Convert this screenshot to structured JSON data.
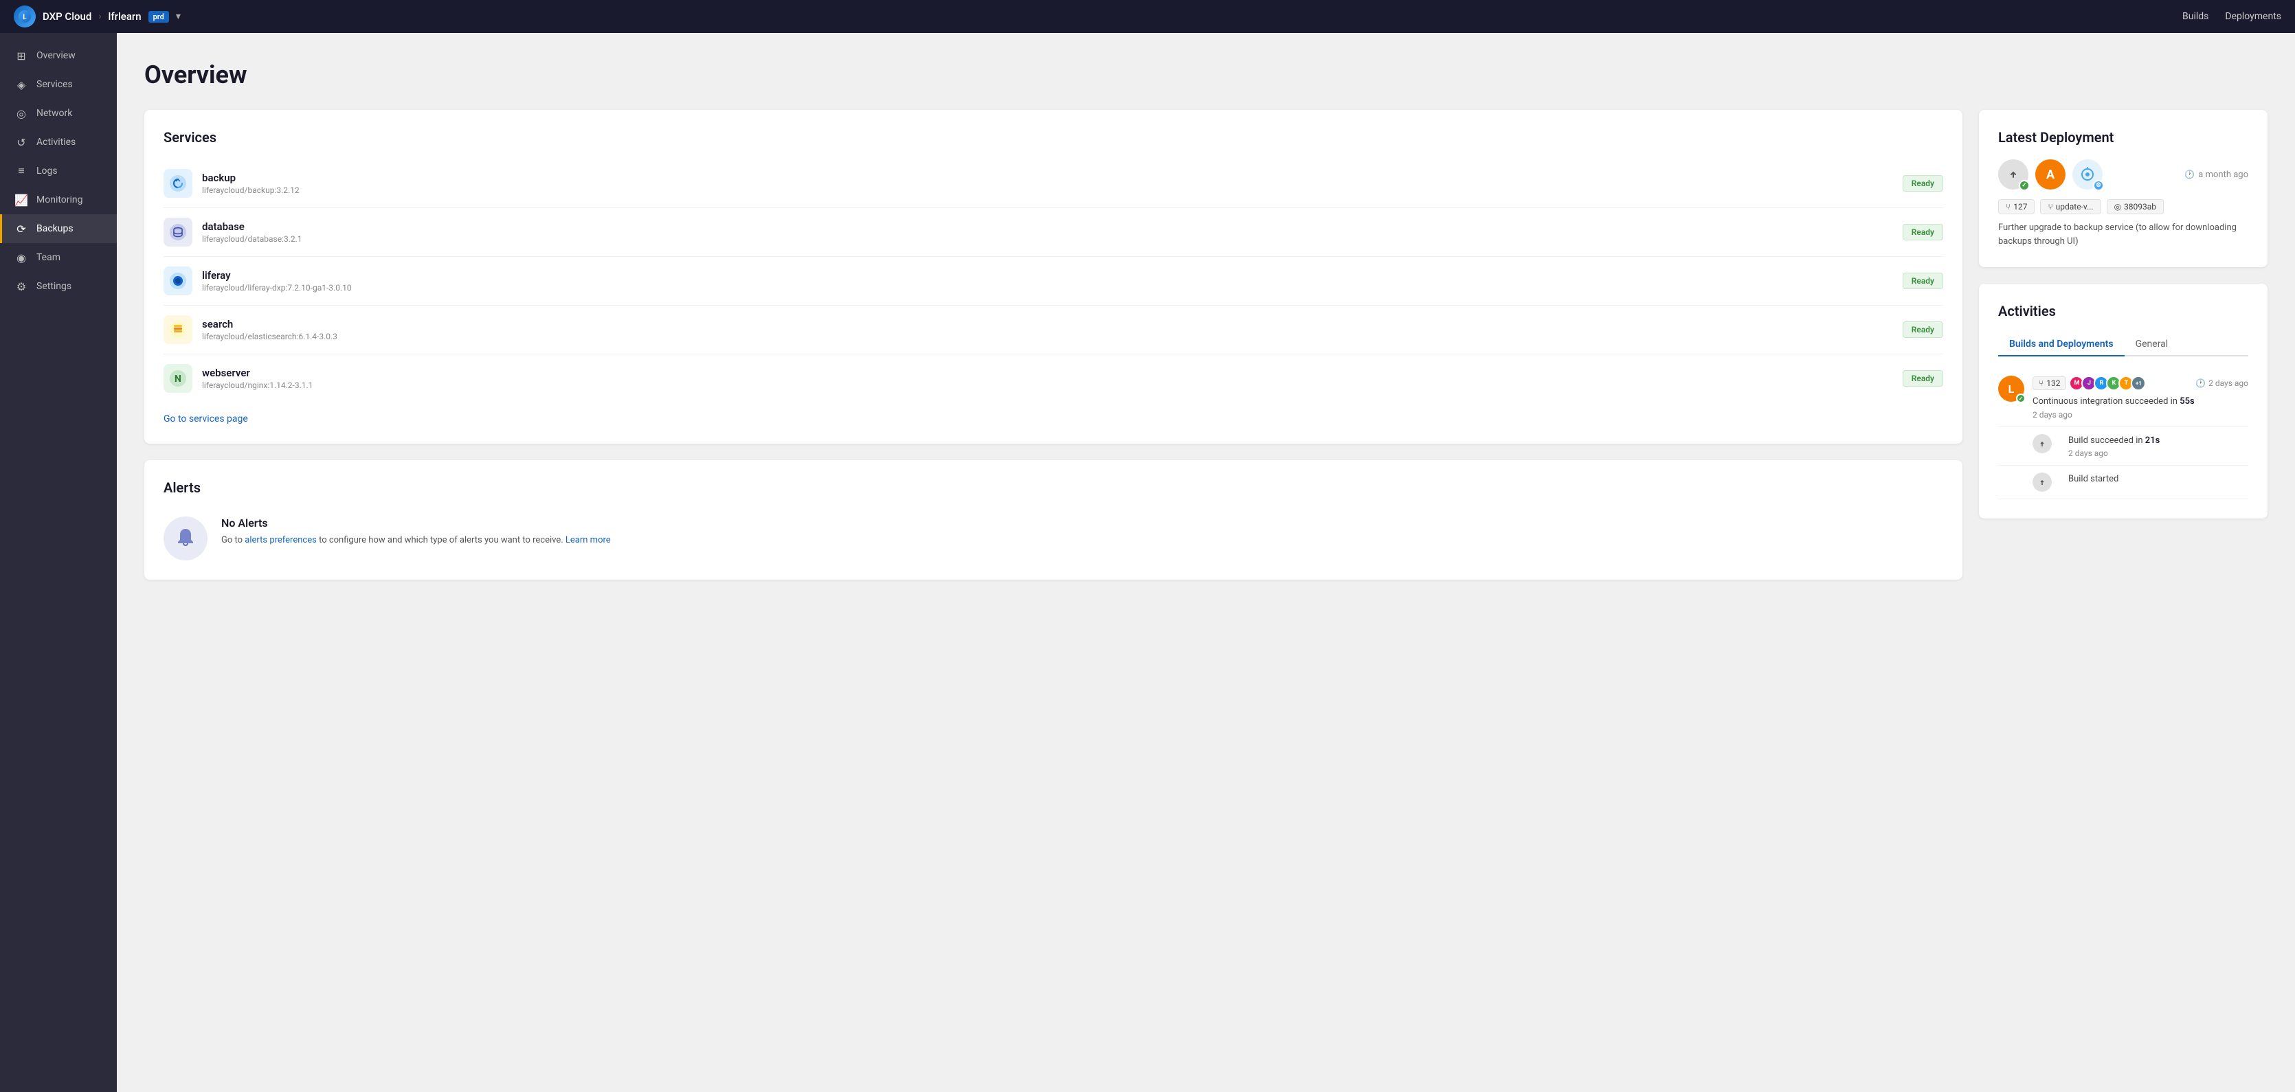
{
  "topbar": {
    "brand": "DXP Cloud",
    "separator": ">",
    "project": "lfrlearn",
    "badge": "prd",
    "nav_links": [
      "Builds",
      "Deployments"
    ]
  },
  "sidebar": {
    "items": [
      {
        "id": "overview",
        "label": "Overview",
        "icon": "⊞",
        "active": false
      },
      {
        "id": "services",
        "label": "Services",
        "icon": "◈",
        "active": false
      },
      {
        "id": "network",
        "label": "Network",
        "icon": "◎",
        "active": false
      },
      {
        "id": "activities",
        "label": "Activities",
        "icon": "↺",
        "active": false
      },
      {
        "id": "logs",
        "label": "Logs",
        "icon": "≡",
        "active": false
      },
      {
        "id": "monitoring",
        "label": "Monitoring",
        "icon": "📈",
        "active": false
      },
      {
        "id": "backups",
        "label": "Backups",
        "icon": "⟳",
        "active": true
      },
      {
        "id": "team",
        "label": "Team",
        "icon": "◉",
        "active": false
      },
      {
        "id": "settings",
        "label": "Settings",
        "icon": "⚙",
        "active": false
      }
    ]
  },
  "page": {
    "title": "Overview"
  },
  "services_card": {
    "title": "Services",
    "services": [
      {
        "name": "backup",
        "path": "liferaycloud/backup:3.2.12",
        "status": "Ready",
        "icon": "🔄",
        "bg": "svc-backup"
      },
      {
        "name": "database",
        "path": "liferaycloud/database:3.2.1",
        "status": "Ready",
        "icon": "🗄",
        "bg": "svc-database"
      },
      {
        "name": "liferay",
        "path": "liferaycloud/liferay-dxp:7.2.10-ga1-3.0.10",
        "status": "Ready",
        "icon": "🔵",
        "bg": "svc-liferay"
      },
      {
        "name": "search",
        "path": "liferaycloud/elasticsearch:6.1.4-3.0.3",
        "status": "Ready",
        "icon": "🔍",
        "bg": "svc-search"
      },
      {
        "name": "webserver",
        "path": "liferaycloud/nginx:1.14.2-3.1.1",
        "status": "Ready",
        "icon": "🟢",
        "bg": "svc-webserver"
      }
    ],
    "go_link": "Go to services page"
  },
  "alerts_card": {
    "title": "Alerts",
    "no_alerts": "No Alerts",
    "body_text": "Go to",
    "link_text": "alerts preferences",
    "body_text2": "to configure how and which type of alerts you want to receive.",
    "learn_more": "Learn more"
  },
  "latest_deployment": {
    "title": "Latest Deployment",
    "time": "a month ago",
    "tags": [
      {
        "icon": "⑂",
        "label": "127"
      },
      {
        "icon": "⑂",
        "label": "update-v..."
      },
      {
        "icon": "◎",
        "label": "38093ab"
      }
    ],
    "description": "Further upgrade to backup service (to allow for downloading backups through UI)"
  },
  "activities": {
    "title": "Activities",
    "tabs": [
      "Builds and Deployments",
      "General"
    ],
    "active_tab": "Builds and Deployments",
    "items": [
      {
        "avatar_label": "L",
        "avatar_color": "#f57c00",
        "has_check": true,
        "tag": "132",
        "tag_icon": "⑂",
        "avatars": [
          "#e91e63",
          "#9c27b0",
          "#2196f3",
          "#4caf50",
          "#ff9800"
        ],
        "plus_label": "+1",
        "time": "2 days ago",
        "text_main": "Continuous integration succeeded in",
        "text_highlight": "55s",
        "subtext": "2 days ago"
      }
    ],
    "sub_items": [
      {
        "text_main": "Build succeeded in",
        "text_highlight": "21s",
        "subtext": "2 days ago"
      },
      {
        "text_main": "Build started",
        "text_highlight": "",
        "subtext": ""
      }
    ]
  }
}
